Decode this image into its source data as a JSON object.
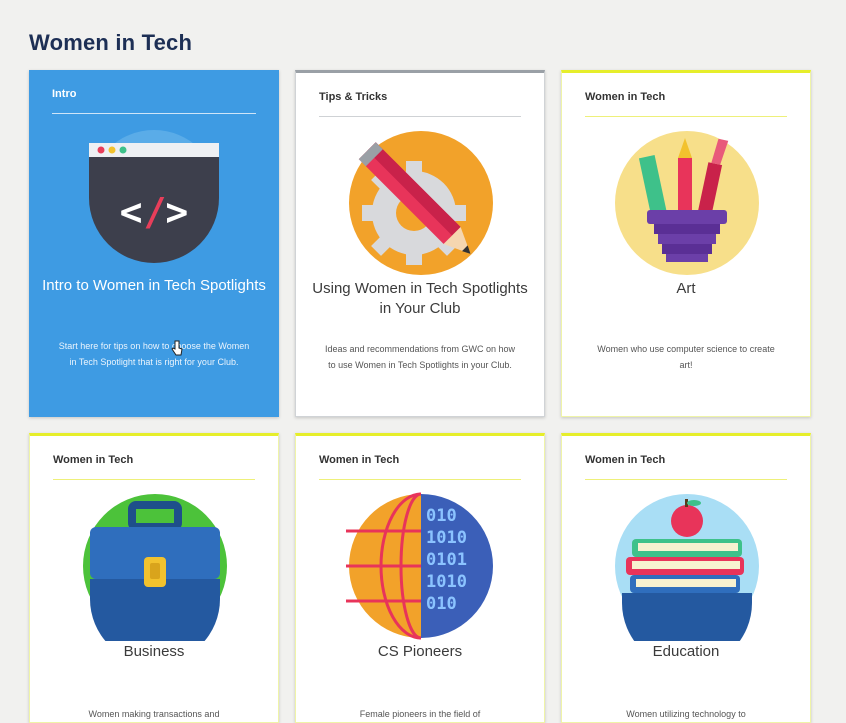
{
  "page": {
    "title": "Women in Tech"
  },
  "cards": [
    {
      "tag": "Intro",
      "title": "Intro to Women in Tech Spotlights",
      "description": "Start here for tips on how to choose the Women in Tech Spotlight that is right for your Club.",
      "icon": "code-window-icon",
      "state": "selected"
    },
    {
      "tag": "Tips & Tricks",
      "title": "Using Women in Tech Spotlights in Your Club",
      "description": "Ideas and recommendations from GWC on how to use Women in Tech Spotlights in your Club.",
      "icon": "pencil-gear-icon"
    },
    {
      "tag": "Women in Tech",
      "title": "Art",
      "description": "Women who use computer science to create art!",
      "icon": "art-supplies-icon"
    },
    {
      "tag": "Women in Tech",
      "title": "Business",
      "description": "Women making transactions and",
      "icon": "briefcase-icon"
    },
    {
      "tag": "Women in Tech",
      "title": "CS Pioneers",
      "description": "Female pioneers in the field of",
      "icon": "binary-globe-icon"
    },
    {
      "tag": "Women in Tech",
      "title": "Education",
      "description": "Women utilizing technology to",
      "icon": "books-apple-icon"
    }
  ],
  "colors": {
    "accent": "#e6ee2a",
    "selected": "#3e9be3",
    "title": "#1d2f55"
  }
}
